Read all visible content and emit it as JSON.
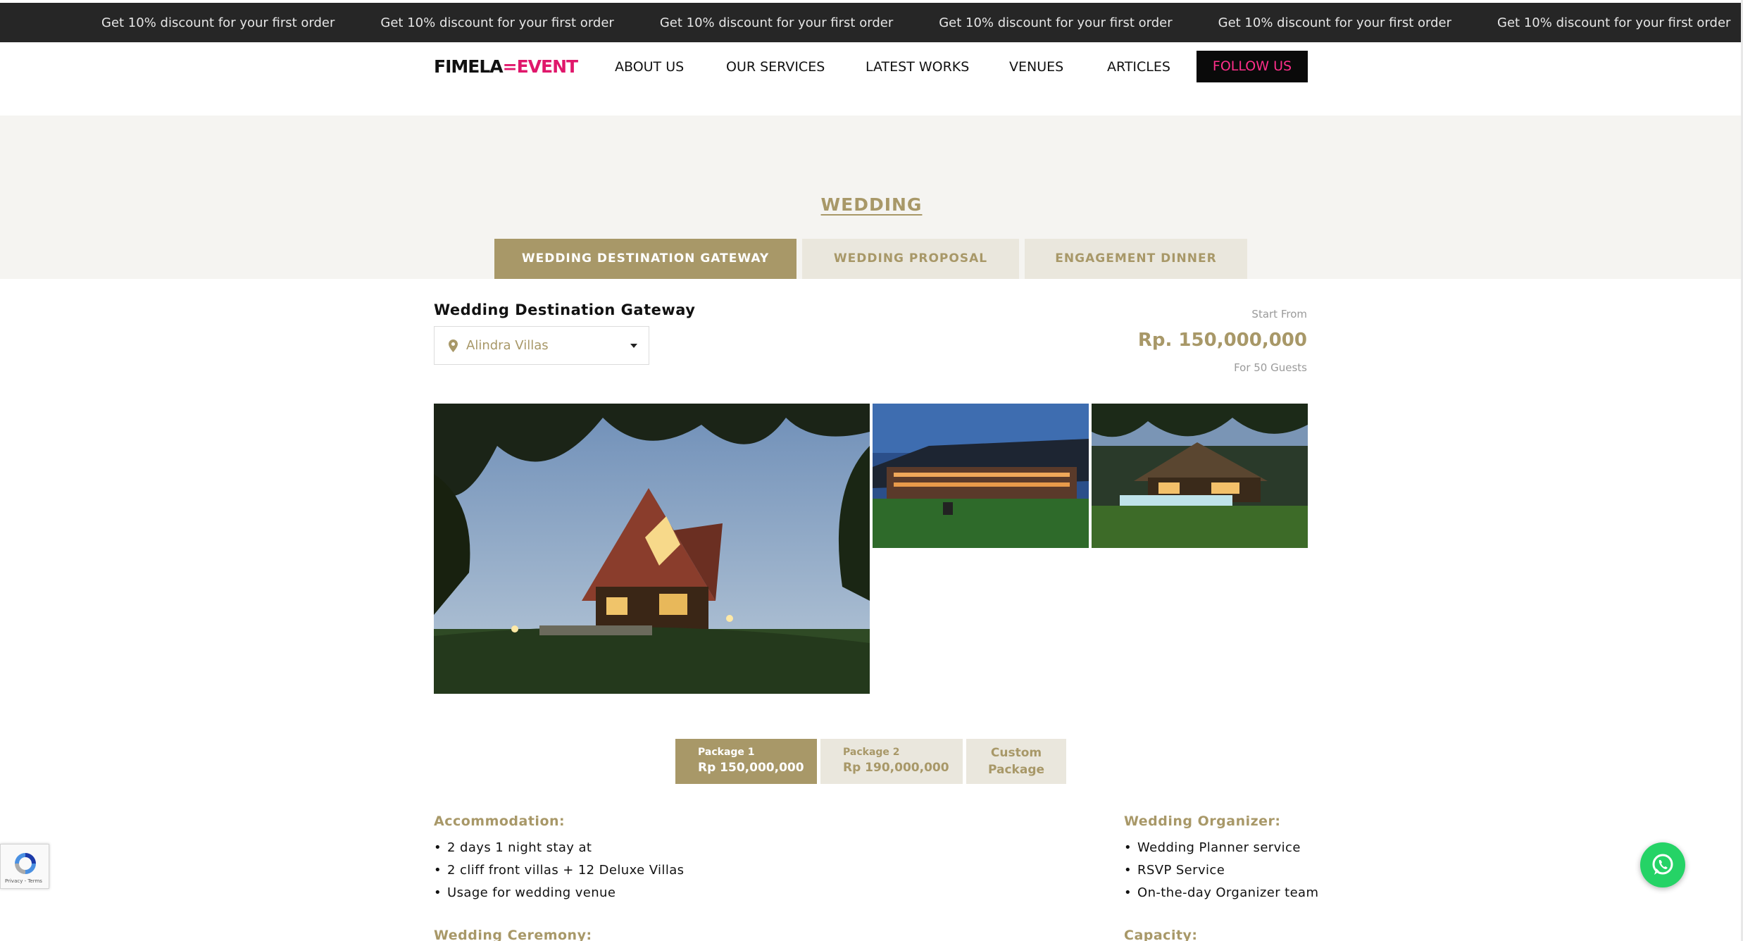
{
  "topbar": {
    "messages": [
      "Get 10% discount for your first order",
      "Get 10% discount for your first order",
      "Get 10% discount for your first order",
      "Get 10% discount for your first order",
      "Get 10% discount for your first order",
      "Get 10% discount for your first order"
    ]
  },
  "nav": {
    "logo_a": "FIMELA",
    "logo_mark": "=",
    "logo_b": "EVENT",
    "items": [
      "ABOUT US",
      "OUR SERVICES",
      "LATEST WORKS",
      "VENUES",
      "ARTICLES"
    ],
    "follow": "FOLLOW US"
  },
  "section": {
    "title": "WEDDING",
    "tabs": [
      "WEDDING DESTINATION GATEWAY",
      "WEDDING PROPOSAL",
      "ENGAGEMENT DINNER"
    ],
    "active_tab": "WEDDING DESTINATION GATEWAY"
  },
  "venue": {
    "label": "Wedding Destination Gateway",
    "select_value": "Alindra Villas",
    "start_from": "Start From",
    "price": "Rp. 150,000,000",
    "guests": "For 50 Guests"
  },
  "gallery": {
    "images": [
      "villa-wooden-house-night",
      "resort-pavilion-lawn",
      "villa-garden-pool-night"
    ]
  },
  "packages": [
    {
      "name": "Package 1",
      "price": "Rp 150,000,000",
      "active": true
    },
    {
      "name": "Package 2",
      "price": "Rp 190,000,000",
      "active": false
    }
  ],
  "custom_package": {
    "line1": "Custom",
    "line2": "Package"
  },
  "details": {
    "accommodation": {
      "title": "Accommodation:",
      "items": [
        "2 days 1 night stay at",
        "2 cliff front villas + 12 Deluxe Villas",
        "Usage for wedding venue"
      ]
    },
    "organizer": {
      "title": "Wedding Organizer:",
      "items": [
        "Wedding Planner service",
        "RSVP Service",
        "On-the-day Organizer team"
      ]
    },
    "ceremony_title": "Wedding Ceremony:",
    "capacity_title": "Capacity:"
  },
  "recaptcha": {
    "text": "Privacy - Terms"
  },
  "colors": {
    "gold": "#a89868",
    "gold_light": "#eae7dd",
    "pink": "#e0176b",
    "dark": "#262626",
    "whatsapp": "#25d366"
  },
  "icons": [
    "location-pin-icon",
    "chevron-down-icon",
    "whatsapp-icon",
    "recaptcha-icon"
  ]
}
